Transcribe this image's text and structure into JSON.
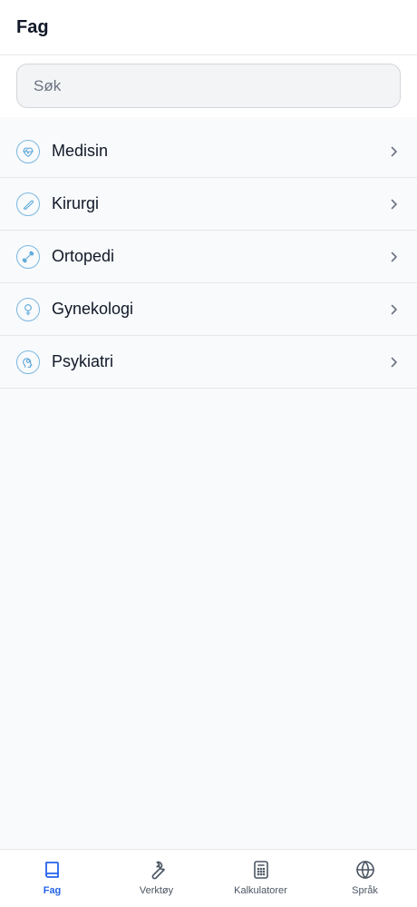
{
  "header": {
    "title": "Fag"
  },
  "search": {
    "placeholder": "Søk",
    "value": ""
  },
  "subjects": [
    {
      "label": "Medisin",
      "icon": "heart-pulse-icon"
    },
    {
      "label": "Kirurgi",
      "icon": "scalpel-icon"
    },
    {
      "label": "Ortopedi",
      "icon": "bone-icon"
    },
    {
      "label": "Gynekologi",
      "icon": "female-symbol-icon"
    },
    {
      "label": "Psykiatri",
      "icon": "head-brain-icon"
    }
  ],
  "tabs": [
    {
      "label": "Fag",
      "icon": "book-icon",
      "active": true
    },
    {
      "label": "Verktøy",
      "icon": "wrench-icon",
      "active": false
    },
    {
      "label": "Kalkulatorer",
      "icon": "calculator-icon",
      "active": false
    },
    {
      "label": "Språk",
      "icon": "globe-icon",
      "active": false
    }
  ],
  "colors": {
    "accent": "#2563eb",
    "icon_outline": "#7db8e0",
    "background": "#f8fafc",
    "border": "#e5e7eb"
  }
}
